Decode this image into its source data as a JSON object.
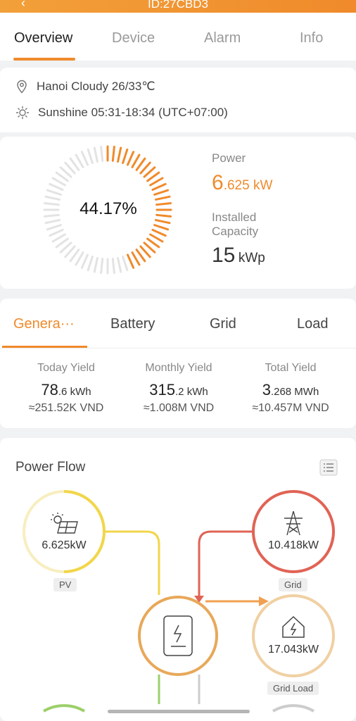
{
  "header": {
    "title": "ID:27CBD3",
    "back_icon": "back-arrow-icon"
  },
  "tabs": [
    {
      "label": "Overview",
      "active": true
    },
    {
      "label": "Device",
      "active": false
    },
    {
      "label": "Alarm",
      "active": false
    },
    {
      "label": "Info",
      "active": false
    }
  ],
  "weather": {
    "location": "Hanoi Cloudy 26/33℃",
    "sunshine": "Sunshine 05:31-18:34 (UTC+07:00)"
  },
  "gauge": {
    "percent_label": "44.17%",
    "percent_value": 0.4417,
    "active_color": "#f08a2b",
    "inactive_color": "#e3e3e3"
  },
  "power": {
    "label": "Power",
    "value_int": "6",
    "value_dec": ".625 kW"
  },
  "capacity": {
    "label_line1": "Installed",
    "label_line2": "Capacity",
    "value": "15",
    "unit": "kWp"
  },
  "gen_tabs": [
    {
      "label": "Genera···",
      "active": true
    },
    {
      "label": "Battery",
      "active": false
    },
    {
      "label": "Grid",
      "active": false
    },
    {
      "label": "Load",
      "active": false
    }
  ],
  "yields": [
    {
      "title": "Today Yield",
      "big": "78",
      "small": ".6 kWh",
      "money": "≈251.52K VND"
    },
    {
      "title": "Monthly Yield",
      "big": "315",
      "small": ".2 kWh",
      "money": "≈1.008M VND"
    },
    {
      "title": "Total Yield",
      "big": "3",
      "small": ".268 MWh",
      "money": "≈10.457M VND"
    }
  ],
  "power_flow": {
    "title": "Power Flow",
    "pv": {
      "value": "6.625kW",
      "tag": "PV",
      "color": "#f2d64a"
    },
    "grid": {
      "value": "10.418kW",
      "tag": "Grid",
      "color": "#e06355"
    },
    "grid_load": {
      "value": "17.043kW",
      "tag": "Grid Load",
      "color": "#f0d0a3"
    },
    "inverter_color": "#e8a85a",
    "flow_color": "#f0a050"
  }
}
